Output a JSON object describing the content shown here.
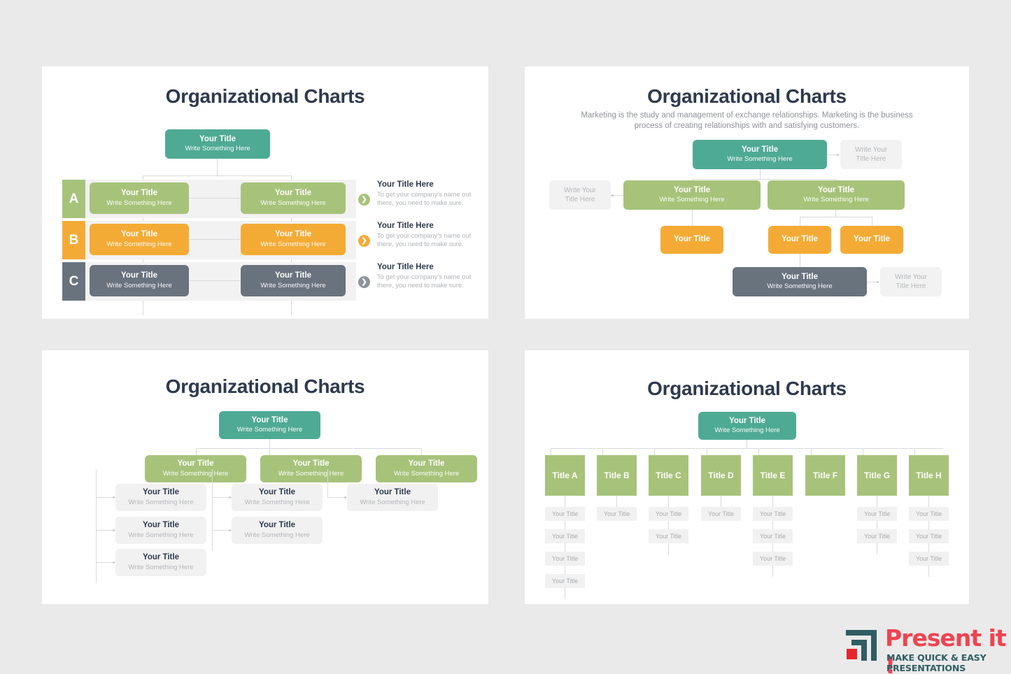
{
  "background_color": "#eaeaea",
  "palette": {
    "teal": "#4faa94",
    "green": "#a7c37a",
    "amber": "#f4ab35",
    "slate": "#69737e",
    "ghost": "#f2f2f2",
    "title": "#2e3a4e",
    "line": "#d9dadc",
    "logo_red": "#ef4351",
    "logo_teal": "#2f5d63"
  },
  "common": {
    "your_title": "Your Title",
    "write_something": "Write Something Here",
    "write_your": "Write Your",
    "title_here": "Title Here"
  },
  "panel1": {
    "title": "Organizational Charts",
    "root": {
      "title": "Your Title",
      "sub": "Write Something Here"
    },
    "rows": [
      {
        "tab": "A",
        "color": "#a7c37a",
        "left": {
          "title": "Your Title",
          "sub": "Write Something Here"
        },
        "right": {
          "title": "Your Title",
          "sub": "Write Something Here"
        },
        "desc_title": "Your Title Here",
        "desc_body": "To get your company’s name out there, you need to make sure."
      },
      {
        "tab": "B",
        "color": "#f4ab35",
        "left": {
          "title": "Your Title",
          "sub": "Write Something Here"
        },
        "right": {
          "title": "Your Title",
          "sub": "Write Something Here"
        },
        "desc_title": "Your Title Here",
        "desc_body": "To get your company’s name out there, you need to make sure."
      },
      {
        "tab": "C",
        "color": "#69737e",
        "left": {
          "title": "Your Title",
          "sub": "Write Something Here"
        },
        "right": {
          "title": "Your Title",
          "sub": "Write Something Here"
        },
        "desc_title": "Your Title Here",
        "desc_body": "To get your company’s name out there, you need to make sure."
      }
    ]
  },
  "panel2": {
    "title": "Organizational Charts",
    "subtitle": "Marketing is the study and management of exchange relationships. Marketing is the business process of creating relationships with and satisfying customers.",
    "root": {
      "title": "Your Title",
      "sub": "Write Something Here"
    },
    "root_note": {
      "l1": "Write Your",
      "l2": "Title Here"
    },
    "left_note": {
      "l1": "Write Your",
      "l2": "Title Here"
    },
    "green_left": {
      "title": "Your Title",
      "sub": "Write Something Here"
    },
    "green_right": {
      "title": "Your Title",
      "sub": "Write Something Here"
    },
    "amber_1": {
      "title": "Your Title"
    },
    "amber_2": {
      "title": "Your Title"
    },
    "amber_3": {
      "title": "Your Title"
    },
    "slate": {
      "title": "Your Title",
      "sub": "Write Something Here"
    },
    "slate_note": {
      "l1": "Write Your",
      "l2": "Title Here"
    }
  },
  "panel3": {
    "title": "Organizational Charts",
    "root": {
      "title": "Your Title",
      "sub": "Write Something Here"
    },
    "branches": [
      {
        "head": {
          "title": "Your Title",
          "sub": "Write Something Here"
        },
        "children": [
          {
            "title": "Your Title",
            "sub": "Write Something Here"
          },
          {
            "title": "Your Title",
            "sub": "Write Something Here"
          },
          {
            "title": "Your Title",
            "sub": "Write Something Here"
          }
        ]
      },
      {
        "head": {
          "title": "Your Title",
          "sub": "Write Something Here"
        },
        "children": [
          {
            "title": "Your Title",
            "sub": "Write Something Here"
          },
          {
            "title": "Your Title",
            "sub": "Write Something Here"
          }
        ]
      },
      {
        "head": {
          "title": "Your Title",
          "sub": "Write Something Here"
        },
        "children": [
          {
            "title": "Your Title",
            "sub": "Write Something Here"
          }
        ]
      }
    ]
  },
  "panel4": {
    "title": "Organizational Charts",
    "root": {
      "title": "Your Title",
      "sub": "Write Something Here"
    },
    "columns": [
      {
        "head": "Title A",
        "items": [
          "Your Title",
          "Your Title",
          "Your Title",
          "Your Title"
        ]
      },
      {
        "head": "Title B",
        "items": [
          "Your Title"
        ]
      },
      {
        "head": "Title C",
        "items": [
          "Your Title",
          "Your Title"
        ]
      },
      {
        "head": "Title D",
        "items": [
          "Your Title"
        ]
      },
      {
        "head": "Title E",
        "items": [
          "Your Title",
          "Your Title",
          "Your Title"
        ]
      },
      {
        "head": "Title F",
        "items": []
      },
      {
        "head": "Title G",
        "items": [
          "Your Title",
          "Your Title"
        ]
      },
      {
        "head": "Title H",
        "items": [
          "Your Title",
          "Your Title",
          "Your Title"
        ]
      }
    ]
  },
  "logo": {
    "word": "Present it !",
    "tagline": "MAKE QUICK & EASY PRESENTATIONS"
  }
}
